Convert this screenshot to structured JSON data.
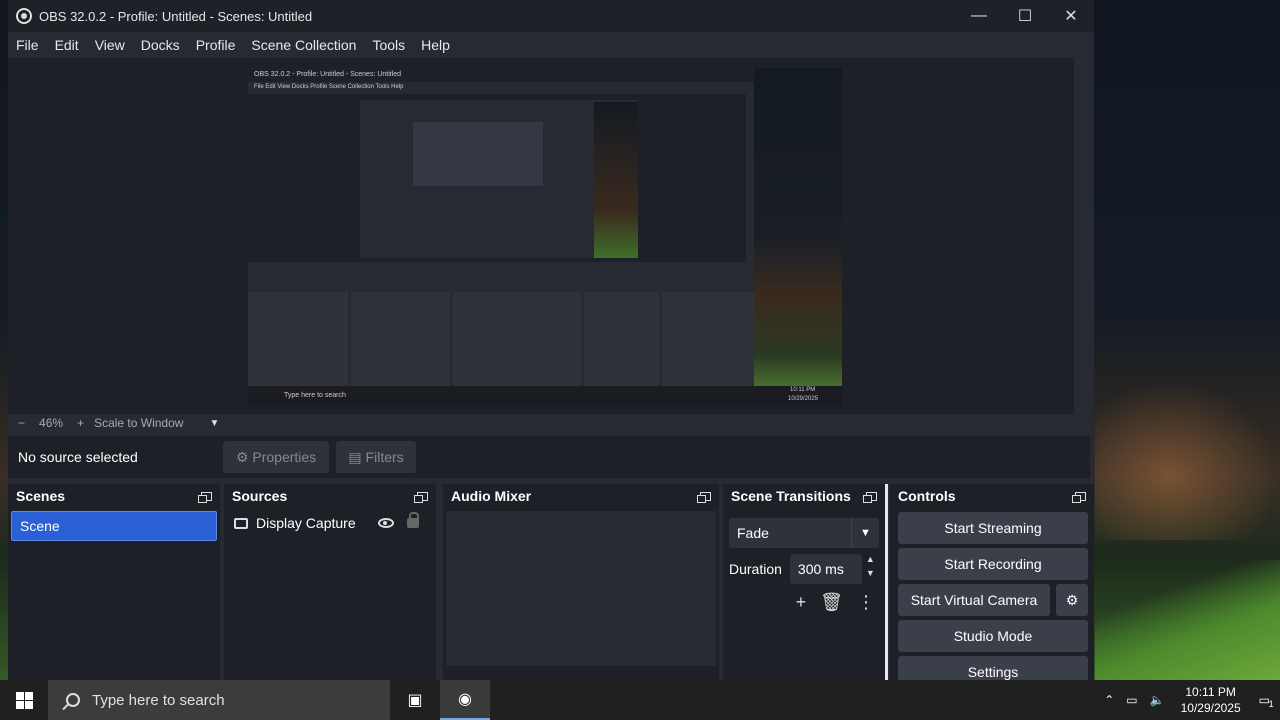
{
  "window": {
    "title": "OBS 32.0.2 - Profile: Untitled - Scenes: Untitled",
    "minimize": "—",
    "maximize": "☐",
    "close": "✕"
  },
  "menu": [
    "File",
    "Edit",
    "View",
    "Docks",
    "Profile",
    "Scene Collection",
    "Tools",
    "Help"
  ],
  "preview": {
    "inner_title": "OBS 32.0.2 - Profile: Untitled - Scenes: Untitled",
    "inner_menu": "File  Edit  View  Docks  Profile  Scene Collection  Tools  Help",
    "inner_taskbar": "Type here to search",
    "inner_time": "10:11 PM",
    "inner_date": "10/29/2025"
  },
  "zoom": {
    "minus": "−",
    "level": "46%",
    "plus": "+",
    "mode": "Scale to Window"
  },
  "source_bar": {
    "status": "No source selected",
    "properties": "Properties",
    "filters": "Filters"
  },
  "scenes": {
    "title": "Scenes",
    "items": [
      "Scene"
    ]
  },
  "sources": {
    "title": "Sources",
    "items": [
      "Display Capture"
    ]
  },
  "audio_mixer": {
    "title": "Audio Mixer"
  },
  "transitions": {
    "title": "Scene Transitions",
    "selected": "Fade",
    "duration_label": "Duration",
    "duration_value": "300 ms"
  },
  "controls": {
    "title": "Controls",
    "start_streaming": "Start Streaming",
    "start_recording": "Start Recording",
    "start_virtual_camera": "Start Virtual Camera",
    "studio_mode": "Studio Mode",
    "settings": "Settings"
  },
  "taskbar": {
    "search_placeholder": "Type here to search",
    "time": "10:11 PM",
    "date": "10/29/2025",
    "notification_count": "1"
  },
  "colors": {
    "accent": "#2b5fd6",
    "window_bg": "#272a33",
    "dock_bg": "#1e2027"
  }
}
